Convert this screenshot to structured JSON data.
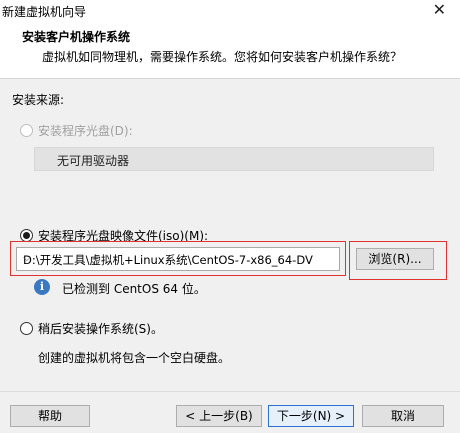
{
  "window": {
    "title": "新建虚拟机向导",
    "close_glyph": "✕"
  },
  "header": {
    "title": "安装客户机操作系统",
    "subtitle": "虚拟机如同物理机，需要操作系统。您将如何安装客户机操作系统？"
  },
  "install_source": {
    "label": "安装来源:",
    "disc_option": {
      "label": "安装程序光盘(D):",
      "enabled": false,
      "selected": false
    },
    "disc_dropdown": {
      "value": "无可用驱动器",
      "enabled": false
    },
    "iso_option": {
      "label": "安装程序光盘映像文件(iso)(M):",
      "selected": true
    },
    "iso_path": {
      "value": "D:\\开发工具\\虚拟机+Linux系统\\CentOS-7-x86_64-DV"
    },
    "browse_label": "浏览(R)...",
    "detected_text": "已检测到 CentOS 64 位。",
    "later_option": {
      "label": "稍后安装操作系统(S)。",
      "selected": false
    },
    "later_description": "创建的虚拟机将包含一个空白硬盘。"
  },
  "footer": {
    "help_label": "帮助",
    "back_label": "< 上一步(B)",
    "next_label": "下一步(N) >",
    "cancel_label": "取消"
  },
  "colors": {
    "highlight_border": "#e0322f",
    "accent": "#2d6fd2"
  }
}
